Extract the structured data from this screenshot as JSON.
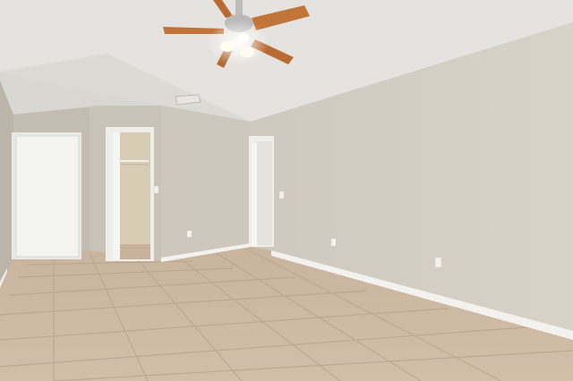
{
  "scene": {
    "subject": "empty-room-interior",
    "colors": {
      "ceiling": "#e4e3df",
      "ceiling_shadow": "#d6d4cf",
      "wall_right": "#d5cfc6",
      "wall_back": "#cfc9bf",
      "wall_left": "#c4beb3",
      "floor": "#cdb8a3",
      "grout": "#b8a48f",
      "baseboard": "#f3f2ef",
      "door": "#f4f4f2",
      "closet_interior": "#d9ccb4",
      "fan_blade": "#c0743c",
      "fan_body": "#b9b9b9",
      "light": "#fffdf2"
    },
    "elements": [
      "ceiling-fan",
      "air-vent",
      "entry-door",
      "closet-doorway",
      "hallway-doorway",
      "light-switch",
      "power-outlet",
      "tile-floor",
      "baseboard"
    ]
  }
}
